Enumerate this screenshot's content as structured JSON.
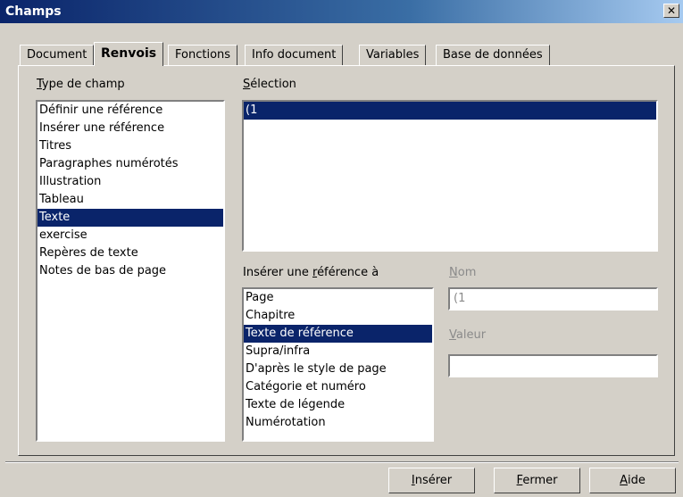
{
  "window": {
    "title": "Champs",
    "close_symbol": "✕"
  },
  "tabs": [
    {
      "label": "Document",
      "active": false
    },
    {
      "label": "Renvois",
      "active": true
    },
    {
      "label": "Fonctions",
      "active": false
    },
    {
      "label": "Info document",
      "active": false
    },
    {
      "label": "Variables",
      "active": false
    },
    {
      "label": "Base de données",
      "active": false
    }
  ],
  "type_de_champ": {
    "label_pre": "",
    "label_key": "T",
    "label_post": "ype de champ",
    "items": [
      "Définir une référence",
      "Insérer une référence",
      "Titres",
      "Paragraphes numérotés",
      "Illustration",
      "Tableau",
      "Texte",
      "exercise",
      "Repères de texte",
      "Notes de bas de page"
    ],
    "selected_index": 6
  },
  "selection": {
    "label_pre": "",
    "label_key": "S",
    "label_post": "élection",
    "items": [
      "(1"
    ],
    "selected_index": 0
  },
  "inserer_reference": {
    "label_pre": "Insérer une ",
    "label_key": "r",
    "label_post": "éférence à",
    "items": [
      "Page",
      "Chapitre",
      "Texte de référence",
      "Supra/infra",
      "D'après le style de page",
      "Catégorie et numéro",
      "Texte de légende",
      "Numérotation"
    ],
    "selected_index": 2
  },
  "nom": {
    "label_pre": "",
    "label_key": "N",
    "label_post": "om",
    "value": "(1"
  },
  "valeur": {
    "label_pre": "",
    "label_key": "V",
    "label_post": "aleur",
    "value": ""
  },
  "buttons": {
    "inserer": {
      "pre": "",
      "key": "I",
      "post": "nsérer"
    },
    "fermer": {
      "pre": "",
      "key": "F",
      "post": "ermer"
    },
    "aide": {
      "pre": "",
      "key": "A",
      "post": "ide"
    }
  }
}
